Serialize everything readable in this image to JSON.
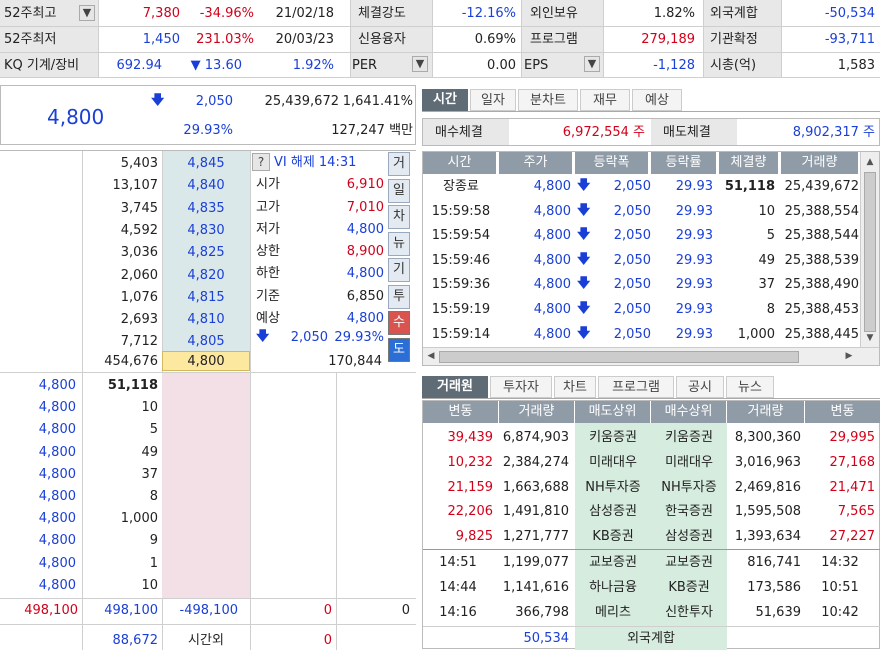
{
  "summary": [
    {
      "l1": "52주최고",
      "v1": "7,380",
      "v2": "-34.96%",
      "v3": "21/02/18",
      "l2": "체결강도",
      "v4": "-12.16%",
      "l3": "외인보유",
      "v5": "1.82%",
      "l4": "외국계합",
      "v6": "-50,534"
    },
    {
      "l1": "52주최저",
      "v1": "1,450",
      "v2": "231.03%",
      "v3": "20/03/23",
      "l2": "신용융자",
      "v4": "0.69%",
      "l3": "프로그램",
      "v5": "279,189",
      "l4": "기관확정",
      "v6": "-93,711"
    },
    {
      "l1": "KQ 기계/장비",
      "v1": "692.94",
      "v2": "▼ 13.60",
      "v3": "1.92%",
      "l2": "PER",
      "v4": "0.00",
      "l3": "EPS",
      "v5": "-1,128",
      "l4": "시총(억)",
      "v6": "1,583"
    }
  ],
  "price": {
    "current": "4,800",
    "change": "2,050",
    "volume": "25,439,672",
    "rate": "1,641.41%",
    "pct": "29.93%",
    "amount": "127,247 백만"
  },
  "orderbook": {
    "ask_qty": [
      "5,403",
      "13,107",
      "3,745",
      "4,592",
      "3,036",
      "2,060",
      "1,076",
      "2,693",
      "7,712"
    ],
    "ask_price": [
      "4,845",
      "4,840",
      "4,835",
      "4,830",
      "4,825",
      "4,820",
      "4,815",
      "4,810",
      "4,805"
    ],
    "total_ask": "454,676",
    "cur_price": "4,800",
    "total_bid": "170,844",
    "bid_price": [
      "4,800",
      "4,800",
      "4,800",
      "4,800",
      "4,800",
      "4,800",
      "4,800",
      "4,800",
      "4,800",
      "4,800"
    ],
    "bid_qty": [
      "51,118",
      "10",
      "5",
      "49",
      "37",
      "8",
      "1,000",
      "9",
      "1",
      "10"
    ],
    "foot": {
      "a": "498,100",
      "b": "498,100",
      "c": "-498,100",
      "d": "0",
      "e": "0"
    },
    "foot2": {
      "a": "88,672",
      "b": "시간외",
      "c": "0"
    }
  },
  "info": {
    "vi": "VI 해제 14:31",
    "q": "?",
    "rows": [
      [
        "시가",
        "6,910"
      ],
      [
        "고가",
        "7,010"
      ],
      [
        "저가",
        "4,800"
      ],
      [
        "상한",
        "8,900"
      ],
      [
        "하한",
        "4,800"
      ],
      [
        "기준",
        "6,850"
      ],
      [
        "예상",
        "4,800"
      ]
    ],
    "exp_change": "2,050",
    "exp_pct": "29.93%"
  },
  "vtabs": [
    "거",
    "일",
    "차",
    "뉴",
    "기",
    "투",
    "수",
    "도"
  ],
  "tabs_top": [
    "시간",
    "일자",
    "분차트",
    "재무",
    "예상"
  ],
  "buy_label": "매수체결",
  "buy_val": "6,972,554 주",
  "sell_label": "매도체결",
  "sell_val": "8,902,317 주",
  "ticks": {
    "headers": [
      "시간",
      "주가",
      "등락폭",
      "등락률",
      "체결량",
      "거래량"
    ],
    "rows": [
      [
        "장종료",
        "4,800",
        "2,050",
        "29.93",
        "51,118",
        "25,439,672"
      ],
      [
        "15:59:58",
        "4,800",
        "2,050",
        "29.93",
        "10",
        "25,388,554"
      ],
      [
        "15:59:54",
        "4,800",
        "2,050",
        "29.93",
        "5",
        "25,388,544"
      ],
      [
        "15:59:46",
        "4,800",
        "2,050",
        "29.93",
        "49",
        "25,388,539"
      ],
      [
        "15:59:36",
        "4,800",
        "2,050",
        "29.93",
        "37",
        "25,388,490"
      ],
      [
        "15:59:19",
        "4,800",
        "2,050",
        "29.93",
        "8",
        "25,388,453"
      ],
      [
        "15:59:14",
        "4,800",
        "2,050",
        "29.93",
        "1,000",
        "25,388,445"
      ]
    ]
  },
  "tabs_bottom": [
    "거래원",
    "투자자",
    "차트",
    "프로그램",
    "공시",
    "뉴스"
  ],
  "broker": {
    "headers": [
      "변동",
      "거래량",
      "매도상위",
      "매수상위",
      "거래량",
      "변동"
    ],
    "rows": [
      [
        "39,439",
        "6,874,903",
        "키움증권",
        "키움증권",
        "8,300,360",
        "29,995"
      ],
      [
        "10,232",
        "2,384,274",
        "미래대우",
        "미래대우",
        "3,016,963",
        "27,168"
      ],
      [
        "21,159",
        "1,663,688",
        "NH투자증",
        "NH투자증",
        "2,469,816",
        "21,471"
      ],
      [
        "22,206",
        "1,491,810",
        "삼성증권",
        "한국증권",
        "1,595,508",
        "7,565"
      ],
      [
        "9,825",
        "1,271,777",
        "KB증권",
        "삼성증권",
        "1,393,634",
        "27,227"
      ]
    ],
    "rows2": [
      [
        "14:51",
        "1,199,077",
        "교보증권",
        "교보증권",
        "816,741",
        "14:32"
      ],
      [
        "14:44",
        "1,141,616",
        "하나금융",
        "KB증권",
        "173,586",
        "10:51"
      ],
      [
        "14:16",
        "366,798",
        "메리츠",
        "신한투자",
        "51,639",
        "10:42"
      ]
    ],
    "foot": {
      "val": "50,534",
      "label": "외국계합"
    }
  }
}
